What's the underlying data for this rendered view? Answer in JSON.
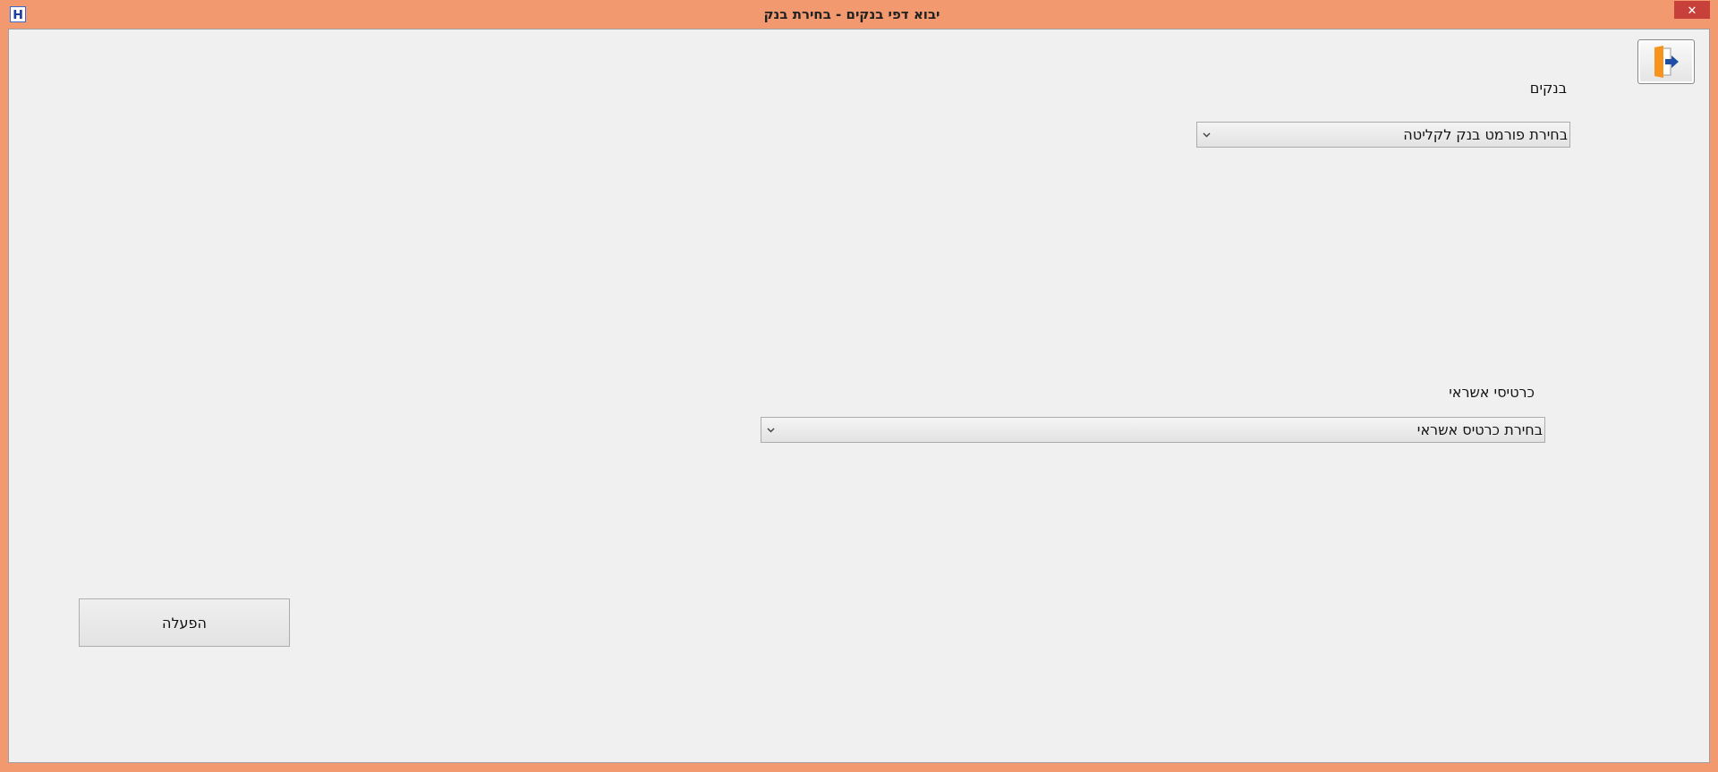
{
  "window": {
    "title": "יבוא דפי בנקים - בחירת בנק",
    "app_icon": "H",
    "close": "✕"
  },
  "banks": {
    "label": "בנקים",
    "select": {
      "value": "בחירת פורמט בנק לקליטה"
    }
  },
  "credit_cards": {
    "label": "כרטיסי אשראי",
    "select": {
      "value": "בחירת כרטיס אשראי"
    }
  },
  "run_button": "הפעלה"
}
